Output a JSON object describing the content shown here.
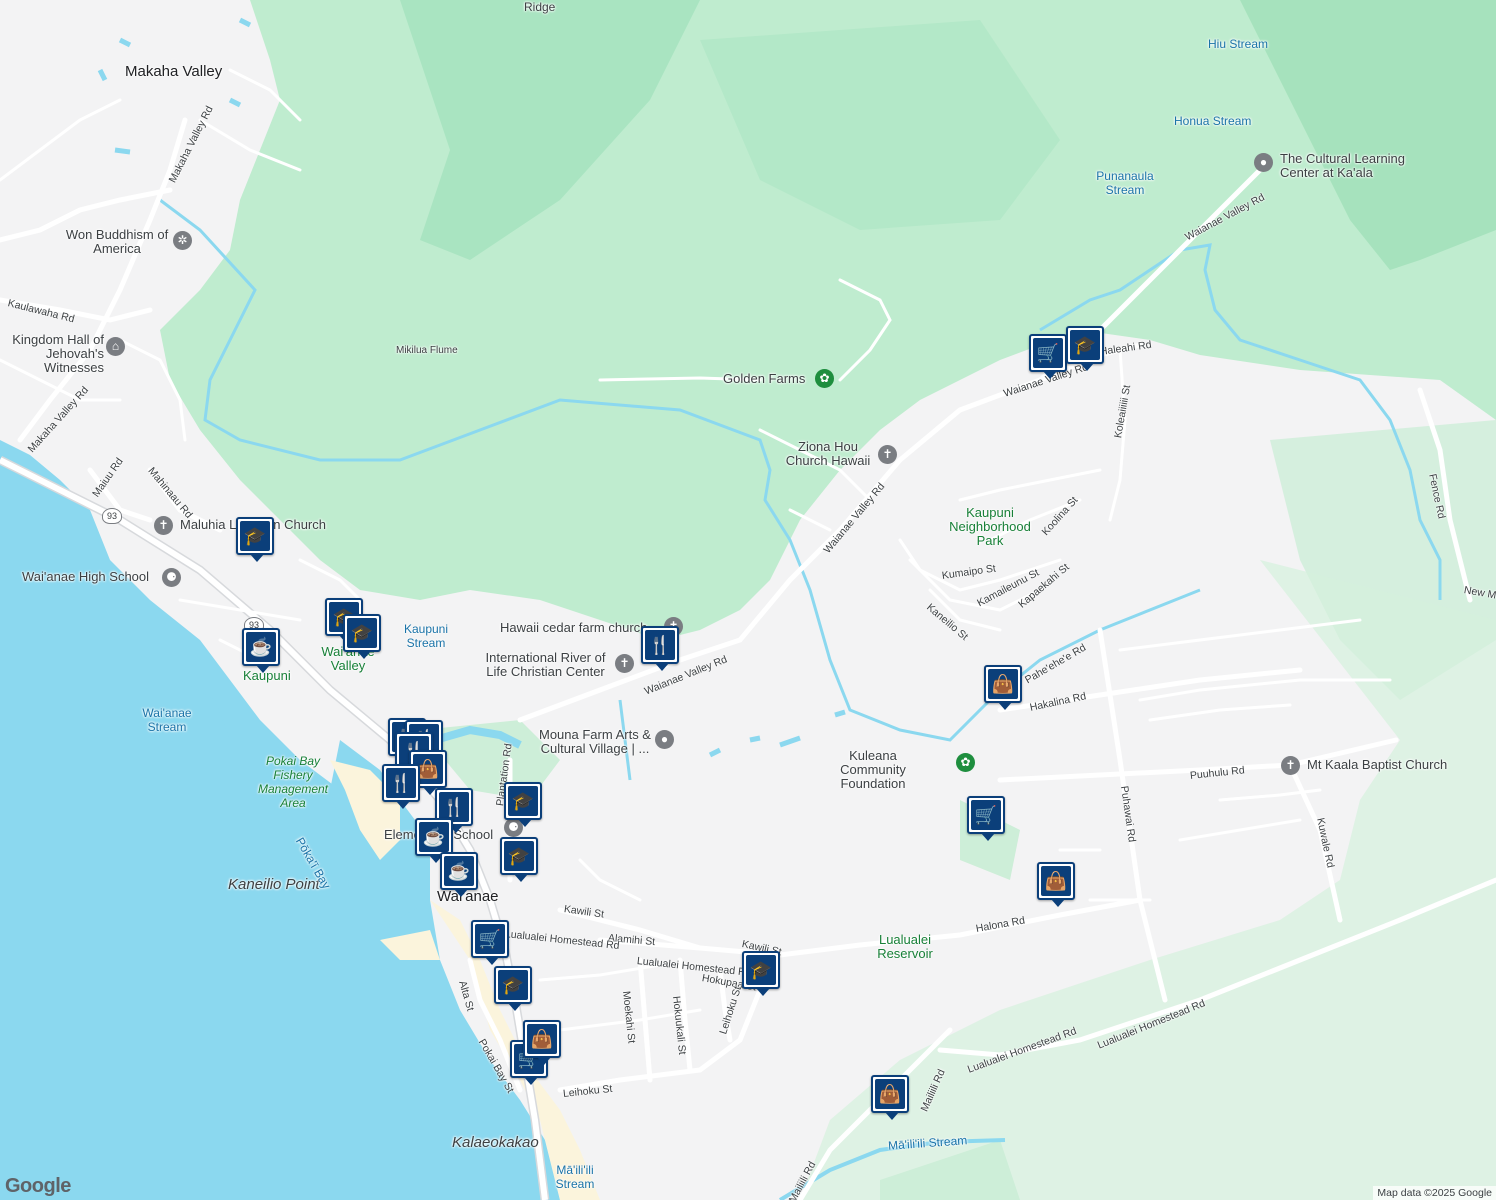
{
  "map": {
    "colors": {
      "land": "#f3f3f4",
      "forest": "#bfeccf",
      "forest_dark": "#a8e6c0",
      "park": "#cdeed8",
      "water": "#8bd8ef",
      "road": "#ffffff",
      "highway": "#d7d9dc",
      "pin": "#0b3f7a"
    },
    "area_labels": [
      {
        "text": "Makaha Valley"
      },
      {
        "text": "Kaneilio Point"
      },
      {
        "text": "Kalaeokakao"
      },
      {
        "text": "Wai'anae"
      },
      {
        "text": "Ridge"
      }
    ],
    "water_labels": [
      {
        "text": "Hiu Stream"
      },
      {
        "text": "Honua Stream"
      },
      {
        "text": "Punanaula Stream"
      },
      {
        "text": "Kaupuni Stream"
      },
      {
        "text": "Wai'anae Stream"
      },
      {
        "text": "Pōka'ī Bay"
      },
      {
        "text": "Mā'ili'ili Stream"
      },
      {
        "text": "Mā'ili'ili Stream"
      },
      {
        "text": "Mikilua Flume"
      },
      {
        "text": "Lualualei Reservoir"
      }
    ],
    "park_labels": [
      {
        "text": "Kaupuni Neighborhood Park"
      },
      {
        "text": "Kaupuni"
      },
      {
        "text": "Wai'anae Valley"
      },
      {
        "text": "Pokai Bay Fishery Management Area"
      },
      {
        "text": "Lualualei Reservoir"
      }
    ],
    "poi_labels": [
      {
        "text": "The Cultural Learning Center at Ka'ala",
        "icon": "pin-icon"
      },
      {
        "text": "Won Buddhism of America",
        "icon": "dharma-wheel-icon"
      },
      {
        "text": "Kingdom Hall of Jehovah's Witnesses",
        "icon": "church-icon"
      },
      {
        "text": "Golden Farms",
        "icon": "flower-icon"
      },
      {
        "text": "Ziona Hou Church Hawaii",
        "icon": "cross-icon"
      },
      {
        "text": "Maluhia Lutheran Church",
        "icon": "cross-icon"
      },
      {
        "text": "Wai'anae High School",
        "icon": "school-icon"
      },
      {
        "text": "Hawaii cedar farm church",
        "icon": "cross-icon"
      },
      {
        "text": "International River of Life Christian Center",
        "icon": "cross-icon"
      },
      {
        "text": "Mouna Farm Arts & Cultural Village | ...",
        "icon": "pin-icon"
      },
      {
        "text": "Kuleana Community Foundation",
        "icon": "flower-icon"
      },
      {
        "text": "Mt Kaala Baptist Church",
        "icon": "cross-icon"
      },
      {
        "text": "Elementary School",
        "icon": "school-icon"
      }
    ],
    "road_labels": [
      "Makaha Valley Rd",
      "Makaha Valley Rd",
      "Kaulawaha Rd",
      "Maiuu Rd",
      "Mahinaau Rd",
      "Waianae Valley Rd",
      "Waianae Valley Rd",
      "Waianae Valley Rd",
      "Waianae Valley Rd",
      "Haleahi Rd",
      "Koleaiiiiii St",
      "Koolina St",
      "Kaneilio St",
      "Kumaipo St",
      "Kamaileunu St",
      "Kapaekahi St",
      "Pahe'ehe'e Rd",
      "Hakalina Rd",
      "Puuhulu Rd",
      "Puhawai Rd",
      "Kuwale Rd",
      "Fence Rd",
      "New M",
      "Halona Rd",
      "Plantation Rd",
      "Kawili St",
      "Kawili St",
      "Alamihi St",
      "Lualualei Homestead Rd",
      "Lualualei Homestead Rd",
      "Lualualei Homestead Rd",
      "Lualualei Homestead Rd",
      "Hokupaa St",
      "Moekahi St",
      "Hokuukali St",
      "Leihoku St",
      "Leihoku St",
      "Alta St",
      "Pokai Bay St",
      "Mailiili Rd",
      "Mailiili Rd"
    ],
    "shields": [
      "93",
      "93"
    ],
    "markers": [
      {
        "type": "shopping-cart-icon"
      },
      {
        "type": "graduation-cap-icon"
      },
      {
        "type": "graduation-cap-icon"
      },
      {
        "type": "graduation-cap-icon"
      },
      {
        "type": "graduation-cap-icon"
      },
      {
        "type": "coffee-icon"
      },
      {
        "type": "restaurant-icon"
      },
      {
        "type": "shopping-bag-icon"
      },
      {
        "type": "shopping-cart-icon"
      },
      {
        "type": "shopping-bag-icon"
      },
      {
        "type": "graduation-cap-icon"
      },
      {
        "type": "graduation-cap-icon"
      },
      {
        "type": "graduation-cap-icon"
      },
      {
        "type": "graduation-cap-icon"
      },
      {
        "type": "shopping-cart-icon"
      },
      {
        "type": "shopping-cart-icon"
      },
      {
        "type": "shopping-bag-icon"
      },
      {
        "type": "shopping-bag-icon"
      },
      {
        "type": "restaurant-icon"
      },
      {
        "type": "restaurant-icon"
      },
      {
        "type": "restaurant-icon"
      },
      {
        "type": "shopping-bag-icon"
      },
      {
        "type": "restaurant-icon"
      },
      {
        "type": "restaurant-icon"
      },
      {
        "type": "coffee-icon"
      },
      {
        "type": "coffee-icon"
      }
    ],
    "google_logo": "Google",
    "attribution": "Map data ©2025 Google"
  }
}
